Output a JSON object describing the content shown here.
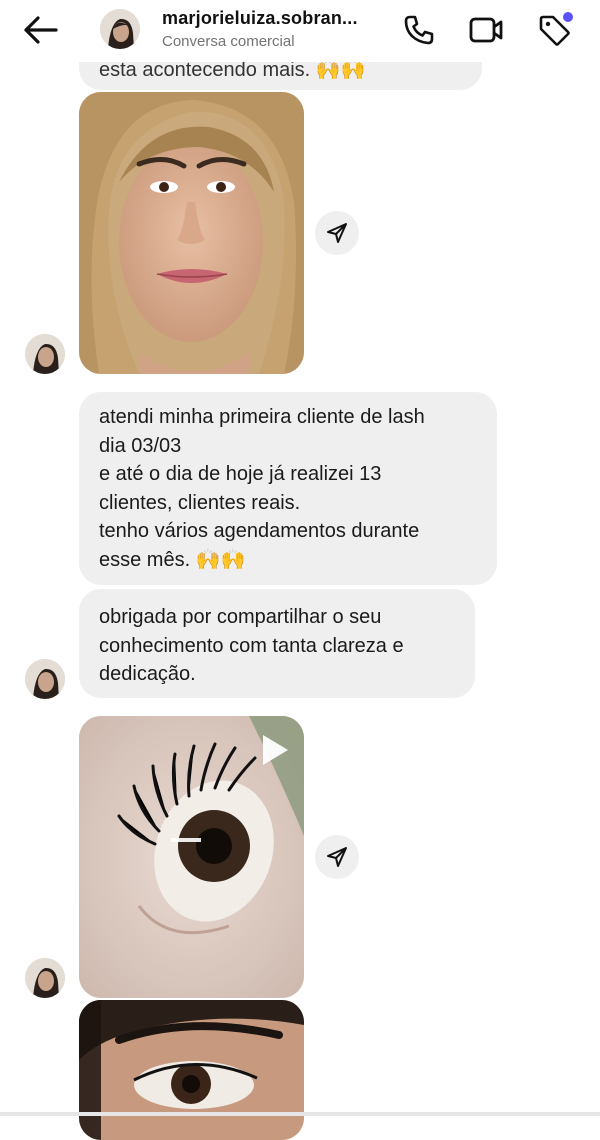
{
  "header": {
    "title": "marjorieluiza.sobran...",
    "subtitle": "Conversa comercial",
    "accent": "#5b51f5"
  },
  "icons": {
    "back": "arrow-left-icon",
    "call": "phone-icon",
    "video": "video-camera-icon",
    "label": "tag-icon",
    "share": "paper-plane-icon",
    "play": "play-icon"
  },
  "messages": {
    "partial_prev": "esta acontecendo mais. 🙌🙌",
    "bubble1": {
      "lines": [
        "atendi minha primeira cliente de lash",
        "dia 03/03",
        "e até o dia de hoje já realizei 13",
        "clientes, clientes reais.",
        "tenho vários agendamentos durante",
        "esse mês. 🙌🙌"
      ]
    },
    "bubble2": {
      "lines": [
        "obrigada por compartilhar o seu",
        "conhecimento com tanta clareza e",
        "dedicação."
      ]
    }
  },
  "colors": {
    "bubble_bg": "#efefef",
    "subtitle_gray": "#737373"
  }
}
